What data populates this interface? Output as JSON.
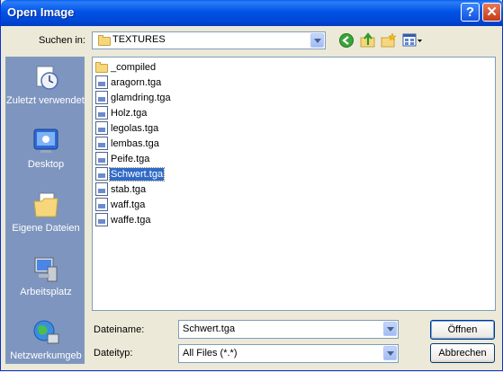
{
  "window": {
    "title": "Open Image",
    "help_icon": "?",
    "close_icon": "✕"
  },
  "toolbar": {
    "look_in_label": "Suchen in:",
    "look_in_value": "TEXTURES",
    "icons": [
      "back-icon",
      "up-folder-icon",
      "new-folder-icon",
      "view-menu-icon"
    ]
  },
  "places": [
    {
      "label": "Zuletzt verwendete D...",
      "icon": "recent-documents-icon"
    },
    {
      "label": "Desktop",
      "icon": "desktop-icon"
    },
    {
      "label": "Eigene Dateien",
      "icon": "my-documents-icon"
    },
    {
      "label": "Arbeitsplatz",
      "icon": "my-computer-icon"
    },
    {
      "label": "Netzwerkumgeb",
      "icon": "network-icon"
    }
  ],
  "files": [
    {
      "name": "_compiled",
      "type": "folder"
    },
    {
      "name": "aragorn.tga",
      "type": "file"
    },
    {
      "name": "glamdring.tga",
      "type": "file"
    },
    {
      "name": "Holz.tga",
      "type": "file"
    },
    {
      "name": "legolas.tga",
      "type": "file"
    },
    {
      "name": "lembas.tga",
      "type": "file"
    },
    {
      "name": "Peife.tga",
      "type": "file"
    },
    {
      "name": "Schwert.tga",
      "type": "file",
      "selected": true
    },
    {
      "name": "stab.tga",
      "type": "file"
    },
    {
      "name": "waff.tga",
      "type": "file"
    },
    {
      "name": "waffe.tga",
      "type": "file"
    }
  ],
  "footer": {
    "filename_label": "Dateiname:",
    "filename_value": "Schwert.tga",
    "filetype_label": "Dateityp:",
    "filetype_value": "All Files (*.*)",
    "open_button": "Öffnen",
    "cancel_button": "Abbrechen"
  },
  "colors": {
    "titlebar": "#0053e6",
    "selection": "#316ac5",
    "places_bar": "#7e95bf"
  }
}
